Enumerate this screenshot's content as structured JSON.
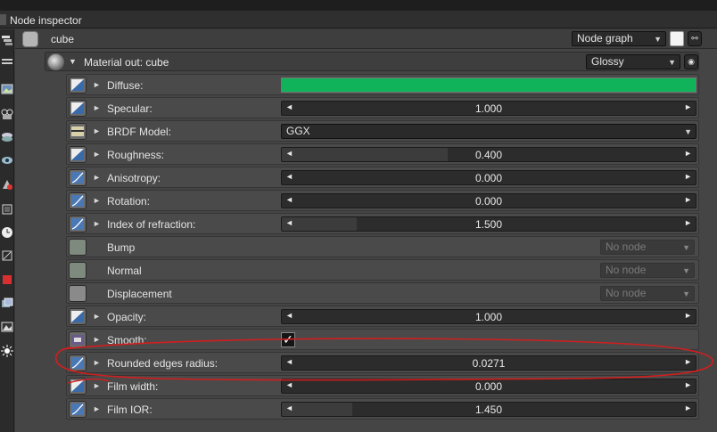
{
  "window": {
    "title": "Node inspector"
  },
  "node": {
    "name": "cube",
    "graph_dropdown": "Node graph"
  },
  "material": {
    "label": "Material out: cube",
    "type_dropdown": "Glossy"
  },
  "params": [
    {
      "label": "Diffuse:",
      "kind": "color",
      "color": "#10b35a",
      "icon": "gradient-icon"
    },
    {
      "label": "Specular:",
      "kind": "slider",
      "value": "1.000",
      "fill": 0.0,
      "icon": "gradient-icon"
    },
    {
      "label": "BRDF Model:",
      "kind": "enum",
      "value": "GGX",
      "icon": "enum-icon"
    },
    {
      "label": "Roughness:",
      "kind": "slider",
      "value": "0.400",
      "fill": 0.4,
      "icon": "gradient-icon"
    },
    {
      "label": "Anisotropy:",
      "kind": "slider",
      "value": "0.000",
      "fill": 0.0,
      "icon": "curve-icon"
    },
    {
      "label": "Rotation:",
      "kind": "slider",
      "value": "0.000",
      "fill": 0.0,
      "icon": "curve-icon"
    },
    {
      "label": "Index of refraction:",
      "kind": "slider",
      "value": "1.500",
      "fill": 0.18,
      "icon": "curve-icon"
    },
    {
      "label": "Bump",
      "kind": "node",
      "value": "No node",
      "icon": "empty-icon"
    },
    {
      "label": "Normal",
      "kind": "node",
      "value": "No node",
      "icon": "empty-icon"
    },
    {
      "label": "Displacement",
      "kind": "node",
      "value": "No node",
      "icon": "empty-icon"
    },
    {
      "label": "Opacity:",
      "kind": "slider",
      "value": "1.000",
      "fill": 0.0,
      "icon": "gradient-icon"
    },
    {
      "label": "Smooth:",
      "kind": "bool",
      "value": "✓",
      "icon": "bool-icon"
    },
    {
      "label": "Rounded edges radius:",
      "kind": "slider",
      "value": "0.0271",
      "fill": 0.0,
      "icon": "curve-icon"
    },
    {
      "label": "Film width:",
      "kind": "slider",
      "value": "0.000",
      "fill": 0.0,
      "icon": "gradient-icon"
    },
    {
      "label": "Film IOR:",
      "kind": "slider",
      "value": "1.450",
      "fill": 0.17,
      "icon": "curve-icon"
    }
  ],
  "arrows": {
    "left": "◄",
    "right": "►",
    "expand": "►",
    "down": "▼",
    "collapse": "▼"
  }
}
